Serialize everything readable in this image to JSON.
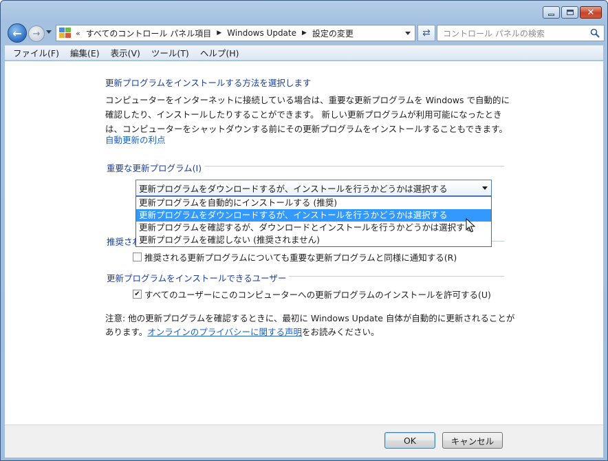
{
  "window": {
    "caption_buttons": {
      "minimize": "minimize",
      "maximize": "maximize",
      "close": "✕"
    }
  },
  "nav": {
    "back_icon": "back-arrow-icon",
    "forward_icon": "forward-arrow-icon",
    "breadcrumb_overflow": "«",
    "breadcrumbs": [
      "すべてのコントロール パネル項目",
      "Windows Update",
      "設定の変更"
    ],
    "search_placeholder": "コントロール パネルの検索"
  },
  "menu": [
    "ファイル(F)",
    "編集(E)",
    "表示(V)",
    "ツール(T)",
    "ヘルプ(H)"
  ],
  "main": {
    "heading": "更新プログラムをインストールする方法を選択します",
    "description": "コンピューターをインターネットに接続している場合は、重要な更新プログラムを Windows で自動的に確認したり、インストールしたりすることができます。 新しい更新プログラムが利用可能になったときは、コンピューターをシャットダウンする前にその更新プログラムをインストールすることもできます。",
    "benefit_link": "自動更新の利点",
    "important_group": {
      "title": "重要な更新プログラム(I)",
      "selected": "更新プログラムをダウンロードするが、インストールを行うかどうかは選択する",
      "options": [
        "更新プログラムを自動的にインストールする (推奨)",
        "更新プログラムをダウンロードするが、インストールを行うかどうかは選択する",
        "更新プログラムを確認するが、ダウンロードとインストールを行うかどうかは選択する",
        "更新プログラムを確認しない (推奨されません)"
      ],
      "highlighted_index": 1
    },
    "recommended_group": {
      "title_visible": "推奨され",
      "checkbox_label": "推奨される更新プログラムについても重要な更新プログラムと同様に通知する(R)",
      "checked": false
    },
    "users_group": {
      "title": "更新プログラムをインストールできるユーザー",
      "checkbox_label": "すべてのユーザーにこのコンピューターへの更新プログラムのインストールを許可する(U)",
      "checked": true
    },
    "note": {
      "prefix": "注意: 他の更新プログラムを確認するときに、最初に Windows Update 自体が自動的に更新されることがあります。",
      "link": "オンラインのプライバシーに関する声明",
      "suffix": "をお読みください。"
    }
  },
  "footer": {
    "ok": "OK",
    "cancel": "キャンセル"
  }
}
